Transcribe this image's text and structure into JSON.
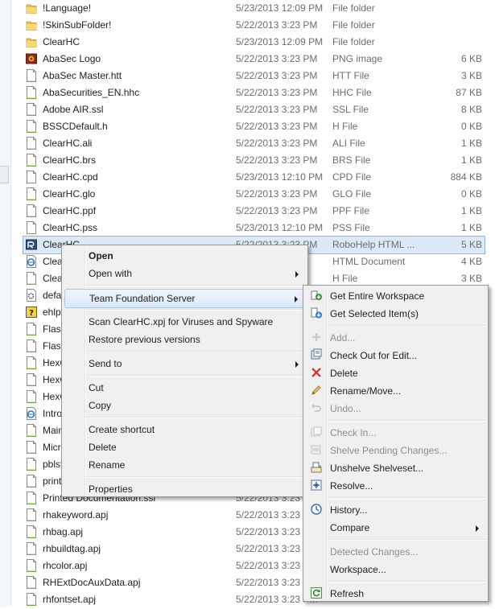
{
  "files": [
    {
      "name": "!Language!",
      "date": "5/23/2013 12:09 PM",
      "type": "File folder",
      "size": "",
      "icon": "folder-icon"
    },
    {
      "name": "!SkinSubFolder!",
      "date": "5/22/2013 3:23 PM",
      "type": "File folder",
      "size": "",
      "icon": "folder-icon"
    },
    {
      "name": "ClearHC",
      "date": "5/23/2013 12:09 PM",
      "type": "File folder",
      "size": "",
      "icon": "folder-icon"
    },
    {
      "name": "AbaSec Logo",
      "date": "5/22/2013 3:23 PM",
      "type": "PNG image",
      "size": "6 KB",
      "icon": "image-file-icon"
    },
    {
      "name": "AbaSec Master.htt",
      "date": "5/22/2013 3:23 PM",
      "type": "HTT File",
      "size": "3 KB",
      "icon": "document-icon"
    },
    {
      "name": "AbaSecurities_EN.hhc",
      "date": "5/22/2013 3:23 PM",
      "type": "HHC File",
      "size": "87 KB",
      "icon": "document-icon"
    },
    {
      "name": "Adobe AIR.ssl",
      "date": "5/22/2013 3:23 PM",
      "type": "SSL File",
      "size": "8 KB",
      "icon": "document-icon"
    },
    {
      "name": "BSSCDefault.h",
      "date": "5/22/2013 3:23 PM",
      "type": "H File",
      "size": "0 KB",
      "icon": "document-icon"
    },
    {
      "name": "ClearHC.ali",
      "date": "5/22/2013 3:23 PM",
      "type": "ALI File",
      "size": "1 KB",
      "icon": "document-icon"
    },
    {
      "name": "ClearHC.brs",
      "date": "5/22/2013 3:23 PM",
      "type": "BRS File",
      "size": "1 KB",
      "icon": "document-icon"
    },
    {
      "name": "ClearHC.cpd",
      "date": "5/23/2013 12:10 PM",
      "type": "CPD File",
      "size": "884 KB",
      "icon": "blank-file-icon"
    },
    {
      "name": "ClearHC.glo",
      "date": "5/22/2013 3:23 PM",
      "type": "GLO File",
      "size": "0 KB",
      "icon": "document-icon"
    },
    {
      "name": "ClearHC.ppf",
      "date": "5/22/2013 3:23 PM",
      "type": "PPF File",
      "size": "1 KB",
      "icon": "document-icon"
    },
    {
      "name": "ClearHC.pss",
      "date": "5/23/2013 12:10 PM",
      "type": "PSS File",
      "size": "1 KB",
      "icon": "blank-file-icon"
    },
    {
      "name": "ClearHC",
      "date": "5/22/2013 3:23 PM",
      "type": "RoboHelp HTML ...",
      "size": "5 KB",
      "icon": "robohelp-project-icon",
      "selected": true
    },
    {
      "name": "Clea",
      "date": "",
      "type": "HTML Document",
      "size": "4 KB",
      "icon": "html-file-icon"
    },
    {
      "name": "Clea",
      "date": "",
      "type": "H File",
      "size": "3 KB",
      "icon": "document-icon"
    },
    {
      "name": "defa",
      "date": "",
      "type": "",
      "size": "",
      "icon": "gear-file-icon"
    },
    {
      "name": "ehlp",
      "date": "",
      "type": "",
      "size": "",
      "icon": "help-file-icon"
    },
    {
      "name": "Flash",
      "date": "",
      "type": "",
      "size": "",
      "icon": "document-icon"
    },
    {
      "name": "Flash",
      "date": "",
      "type": "",
      "size": "",
      "icon": "document-icon"
    },
    {
      "name": "HexC",
      "date": "",
      "type": "",
      "size": "",
      "icon": "document-icon"
    },
    {
      "name": "HexC",
      "date": "",
      "type": "",
      "size": "",
      "icon": "document-icon"
    },
    {
      "name": "HexC",
      "date": "",
      "type": "",
      "size": "",
      "icon": "document-icon"
    },
    {
      "name": "Intro",
      "date": "",
      "type": "",
      "size": "",
      "icon": "html-file-icon"
    },
    {
      "name": "Main",
      "date": "",
      "type": "",
      "size": "",
      "icon": "document-icon"
    },
    {
      "name": "Micr",
      "date": "",
      "type": "",
      "size": "",
      "icon": "document-icon"
    },
    {
      "name": "pblst",
      "date": "",
      "type": "",
      "size": "",
      "icon": "document-icon"
    },
    {
      "name": "print",
      "date": "",
      "type": "",
      "size": "",
      "icon": "document-icon"
    },
    {
      "name": "Printed Documentation.ssl",
      "date": "5/22/2013 3:23 PM",
      "type": "",
      "size": "",
      "icon": "document-icon"
    },
    {
      "name": "rhakeyword.apj",
      "date": "5/22/2013 3:23 PM",
      "type": "",
      "size": "",
      "icon": "document-icon"
    },
    {
      "name": "rhbag.apj",
      "date": "5/22/2013 3:23 PM",
      "type": "",
      "size": "",
      "icon": "document-icon"
    },
    {
      "name": "rhbuildtag.apj",
      "date": "5/22/2013 3:23 PM",
      "type": "",
      "size": "",
      "icon": "document-icon"
    },
    {
      "name": "rhcolor.apj",
      "date": "5/22/2013 3:23 PM",
      "type": "",
      "size": "",
      "icon": "document-icon"
    },
    {
      "name": "RHExtDocAuxData.apj",
      "date": "5/22/2013 3:23 PM",
      "type": "",
      "size": "",
      "icon": "document-icon"
    },
    {
      "name": "rhfontset.apj",
      "date": "5/22/2013 3:23 PM",
      "type": "",
      "size": "",
      "icon": "document-icon"
    }
  ],
  "context_menu": {
    "items": [
      {
        "label": "Open",
        "bold": true
      },
      {
        "label": "Open with",
        "submenu": true
      },
      {
        "separator": true
      },
      {
        "label": "Team Foundation Server",
        "submenu": true,
        "highlighted": true
      },
      {
        "separator": true
      },
      {
        "label": "Scan ClearHC.xpj for Viruses and Spyware"
      },
      {
        "label": "Restore previous versions"
      },
      {
        "separator": true
      },
      {
        "label": "Send to",
        "submenu": true
      },
      {
        "separator": true
      },
      {
        "label": "Cut"
      },
      {
        "label": "Copy"
      },
      {
        "separator": true
      },
      {
        "label": "Create shortcut"
      },
      {
        "label": "Delete"
      },
      {
        "label": "Rename"
      },
      {
        "separator": true
      },
      {
        "label": "Properties"
      }
    ]
  },
  "tfs_menu": {
    "items": [
      {
        "label": "Get Entire Workspace",
        "icon": "get-workspace-icon"
      },
      {
        "label": "Get Selected Item(s)",
        "icon": "get-item-icon"
      },
      {
        "separator": true
      },
      {
        "label": "Add...",
        "icon": "add-icon",
        "disabled": true
      },
      {
        "label": "Check Out for Edit...",
        "icon": "checkout-icon"
      },
      {
        "label": "Delete",
        "icon": "delete-x-icon"
      },
      {
        "label": "Rename/Move...",
        "icon": "rename-pencil-icon"
      },
      {
        "label": "Undo...",
        "icon": "undo-icon",
        "disabled": true
      },
      {
        "separator": true
      },
      {
        "label": "Check In...",
        "icon": "checkin-icon",
        "disabled": true
      },
      {
        "label": "Shelve Pending Changes...",
        "icon": "shelve-icon",
        "disabled": true
      },
      {
        "label": "Unshelve Shelveset...",
        "icon": "unshelve-icon"
      },
      {
        "label": "Resolve...",
        "icon": "resolve-icon"
      },
      {
        "separator": true
      },
      {
        "label": "History...",
        "icon": "history-icon"
      },
      {
        "label": "Compare",
        "submenu": true
      },
      {
        "separator": true
      },
      {
        "label": "Detected Changes...",
        "disabled": true
      },
      {
        "label": "Workspace..."
      },
      {
        "separator": true
      },
      {
        "label": "Refresh",
        "icon": "refresh-icon"
      }
    ]
  },
  "colors": {
    "selection": "#dbe9f9",
    "menu_bg": "#f0f0f0",
    "muted_text": "#6d6d6d",
    "disabled_text": "#8d8d8d"
  }
}
